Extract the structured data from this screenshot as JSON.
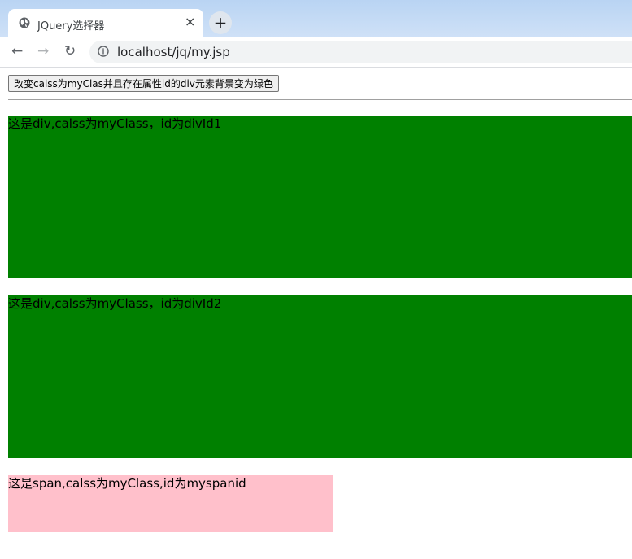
{
  "browser": {
    "tab_title": "JQuery选择器",
    "tab_close": "×",
    "new_tab": "+",
    "url": "localhost/jq/my.jsp",
    "back": "←",
    "forward": "→",
    "reload": "↻"
  },
  "page": {
    "button_label": "改变calss为myClas并且存在属性id的div元素背景变为绿色",
    "div1_text": "这是div,calss为myClass，id为divId1",
    "div2_text": "这是div,calss为myClass，id为divId2",
    "span_text": "这是span,calss为myClass,id为myspanid"
  },
  "colors": {
    "div_background": "#008000",
    "span_background": "#ffc0cb"
  }
}
